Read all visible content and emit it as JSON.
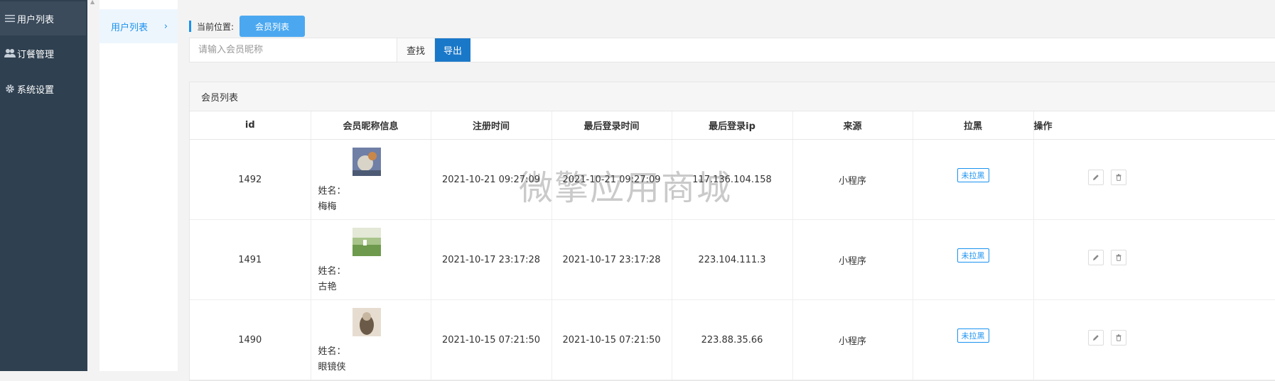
{
  "sidebar": {
    "items": [
      {
        "label": "用户列表",
        "icon": "menu-icon",
        "active": true
      },
      {
        "label": "订餐管理",
        "icon": "users-icon",
        "active": false
      },
      {
        "label": "系统设置",
        "icon": "gear-icon",
        "active": false
      }
    ]
  },
  "subnav": {
    "label": "用户列表",
    "chevron": "›"
  },
  "breadcrumb": {
    "label": "当前位置:",
    "current": "会员列表"
  },
  "search": {
    "placeholder": "请输入会员昵称",
    "find_label": "查找",
    "export_label": "导出"
  },
  "panel": {
    "title": "会员列表"
  },
  "table": {
    "columns": [
      "id",
      "会员昵称信息",
      "注册时间",
      "最后登录时间",
      "最后登录ip",
      "来源",
      "拉黑",
      "操作"
    ],
    "name_prefix": "姓名：",
    "rows": [
      {
        "id": "1492",
        "name": "梅梅",
        "reg_time": "2021-10-21 09:27:09",
        "last_login": "2021-10-21 09:27:09",
        "ip": "117.136.104.158",
        "source": "小程序",
        "blacklist": "未拉黑",
        "avatar_colors": [
          "#6f7fa6",
          "#d9d4c8",
          "#c9874a"
        ]
      },
      {
        "id": "1491",
        "name": "古艳",
        "reg_time": "2021-10-17 23:17:28",
        "last_login": "2021-10-17 23:17:28",
        "ip": "223.104.111.3",
        "source": "小程序",
        "blacklist": "未拉黑",
        "avatar_colors": [
          "#a8c48a",
          "#6d9a4c",
          "#e3e8d7"
        ]
      },
      {
        "id": "1490",
        "name": "眼镜侠",
        "reg_time": "2021-10-15 07:21:50",
        "last_login": "2021-10-15 07:21:50",
        "ip": "223.88.35.66",
        "source": "小程序",
        "blacklist": "未拉黑",
        "avatar_colors": [
          "#c7b7a0",
          "#6b5a48",
          "#e6ddd0"
        ]
      }
    ]
  },
  "watermark": "微擎应用商城",
  "colors": {
    "sidebar_bg": "#2f4050",
    "accent": "#1a92f0",
    "export_btn": "#1a78c9"
  }
}
